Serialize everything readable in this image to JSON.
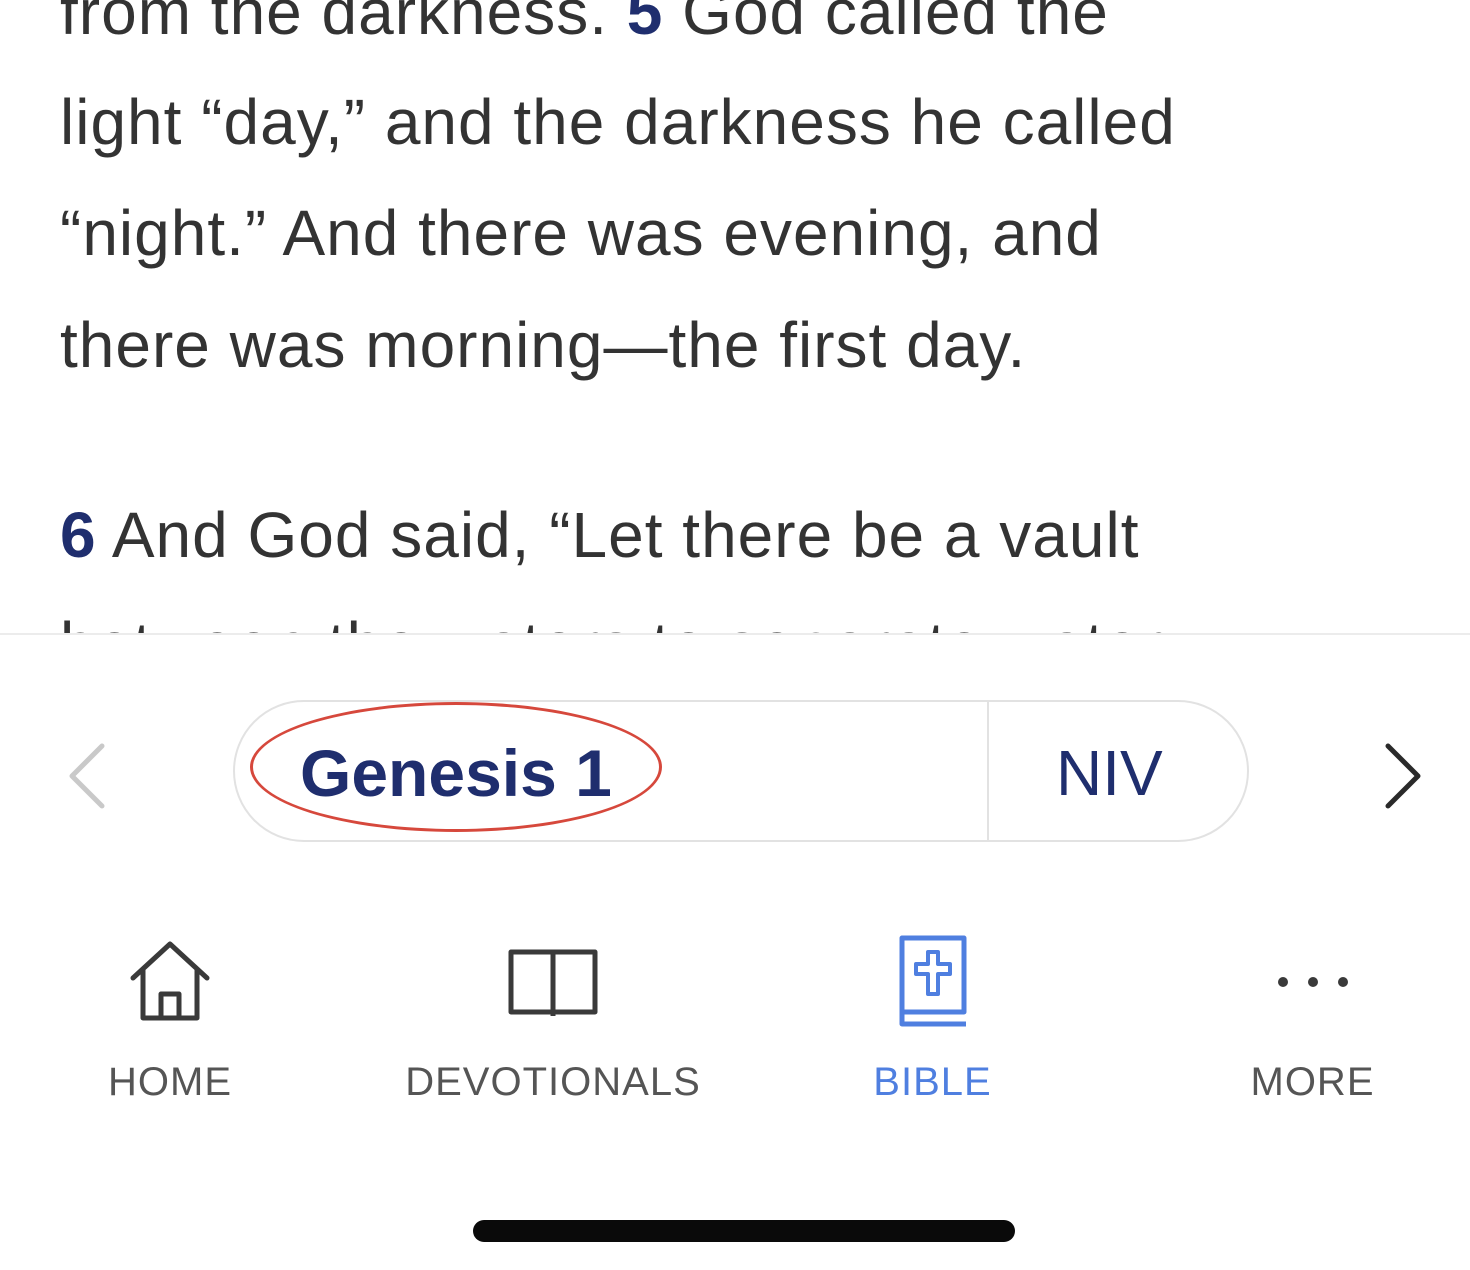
{
  "reader": {
    "line1_text": "from the darkness.",
    "line1_verse": "5",
    "line1_rest": "God called the",
    "line2": "light “day,” and the darkness he called",
    "line3": "“night.” And there was evening, and",
    "line4": "there was morning—the first day.",
    "verse6_num": "6",
    "verse6_text": "And God said, “Let there be a vault",
    "line6": "between the waters to separate water"
  },
  "chapter_nav": {
    "book": "Genesis 1",
    "version": "NIV",
    "prev_icon": "chevron-left-icon",
    "next_icon": "chevron-right-icon"
  },
  "tabs": [
    {
      "label": "HOME",
      "icon": "home-icon",
      "active": false
    },
    {
      "label": "DEVOTIONALS",
      "icon": "open-book-icon",
      "active": false
    },
    {
      "label": "BIBLE",
      "icon": "bible-icon",
      "active": true
    },
    {
      "label": "MORE",
      "icon": "more-dots-icon",
      "active": false
    }
  ],
  "colors": {
    "verse_number": "#1f2e6e",
    "active_tab": "#4f7fe0",
    "annotation": "#d6483c"
  }
}
